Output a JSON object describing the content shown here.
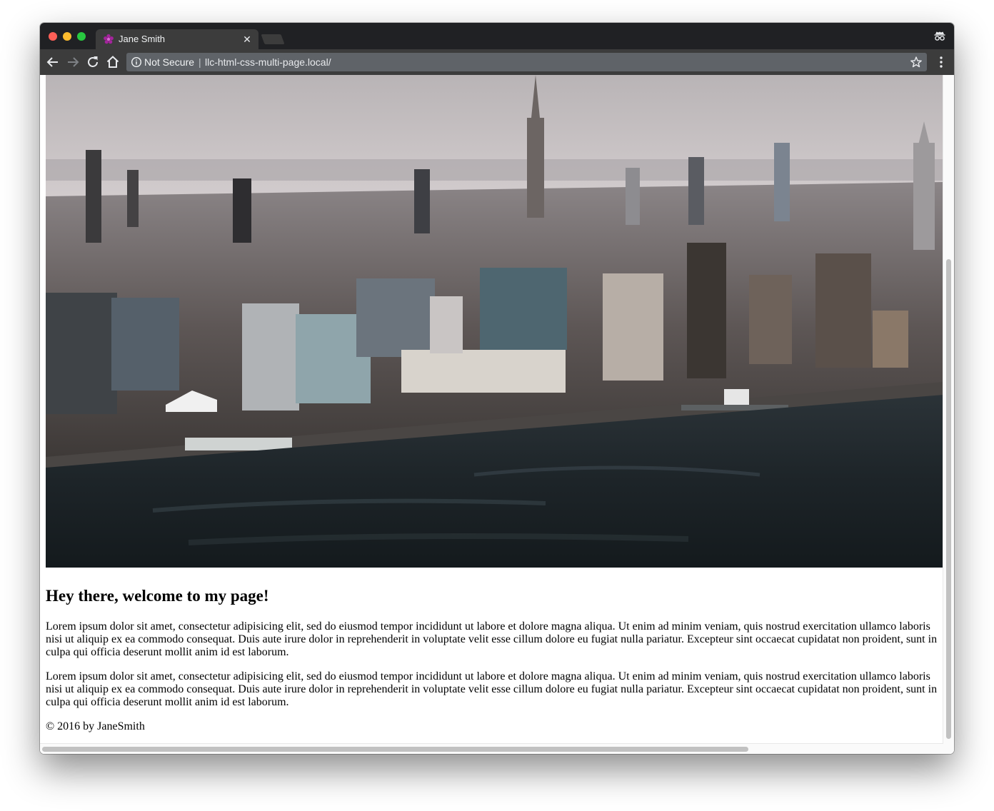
{
  "browser": {
    "tab": {
      "title": "Jane Smith",
      "close_glyph": "✕",
      "favicon": "purple-flower-icon"
    },
    "omnibox": {
      "security_label": "Not Secure",
      "separator": "|",
      "url": "llc-html-css-multi-page.local/"
    },
    "icons": [
      "back-arrow-icon",
      "forward-arrow-icon",
      "reload-icon",
      "home-icon",
      "info-icon",
      "bookmark-star-icon",
      "menu-dots-icon",
      "incognito-icon"
    ]
  },
  "page": {
    "hero_image": "city-skyline-aerial-photo",
    "heading": "Hey there, welcome to my page!",
    "paragraphs": [
      "Lorem ipsum dolor sit amet, consectetur adipisicing elit, sed do eiusmod tempor incididunt ut labore et dolore magna aliqua. Ut enim ad minim veniam, quis nostrud exercitation ullamco laboris nisi ut aliquip ex ea commodo consequat. Duis aute irure dolor in reprehenderit in voluptate velit esse cillum dolore eu fugiat nulla pariatur. Excepteur sint occaecat cupidatat non proident, sunt in culpa qui officia deserunt mollit anim id est laborum.",
      "Lorem ipsum dolor sit amet, consectetur adipisicing elit, sed do eiusmod tempor incididunt ut labore et dolore magna aliqua. Ut enim ad minim veniam, quis nostrud exercitation ullamco laboris nisi ut aliquip ex ea commodo consequat. Duis aute irure dolor in reprehenderit in voluptate velit esse cillum dolore eu fugiat nulla pariatur. Excepteur sint occaecat cupidatat non proident, sunt in culpa qui officia deserunt mollit anim id est laborum."
    ],
    "footer": "© 2016 by JaneSmith"
  },
  "colors": {
    "titlebar": "#202124",
    "toolbar": "#3c3c3c",
    "omnibox": "#5f6368",
    "favicon": "#a4239c"
  }
}
